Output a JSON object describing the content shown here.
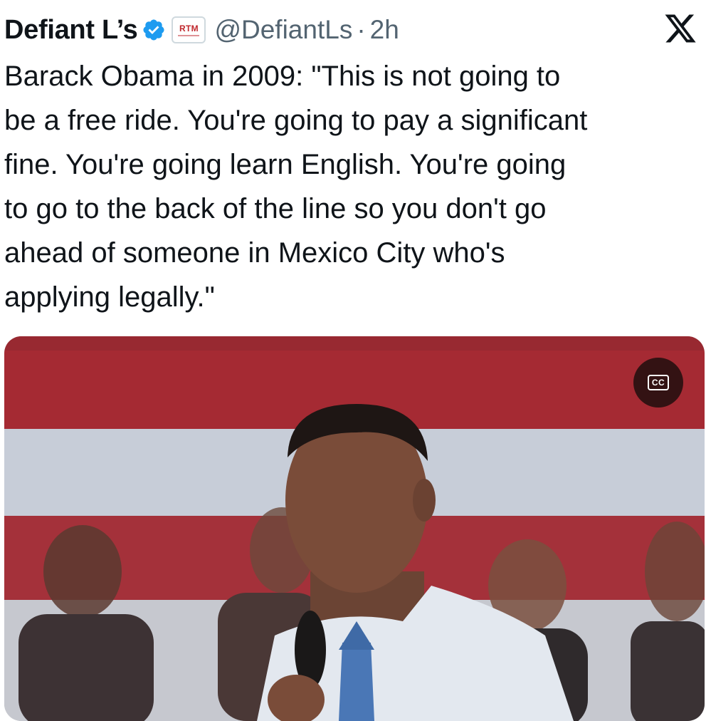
{
  "tweet": {
    "display_name": "Defiant L’s",
    "verified_icon": "verified-badge-icon",
    "affiliate_badge": "RTM",
    "handle": "@DefiantLs",
    "separator": "·",
    "time": "2h",
    "brand_icon": "x-logo-icon",
    "text": "Barack Obama in 2009: \"This is not going to\nbe a free ride. You're going to pay a significant\nfine. You're going learn English. You're going\nto go to the back of the line so you don't go\nahead of someone in Mexico City who's\napplying legally.\""
  },
  "media": {
    "type": "video",
    "cc_label": "CC",
    "cc_icon": "closed-captions-icon"
  },
  "colors": {
    "text_primary": "#0f1419",
    "text_secondary": "#536471",
    "verified_blue": "#1d9bf0",
    "affiliate_red": "#c0282d",
    "flag_red": "#a52a33"
  }
}
